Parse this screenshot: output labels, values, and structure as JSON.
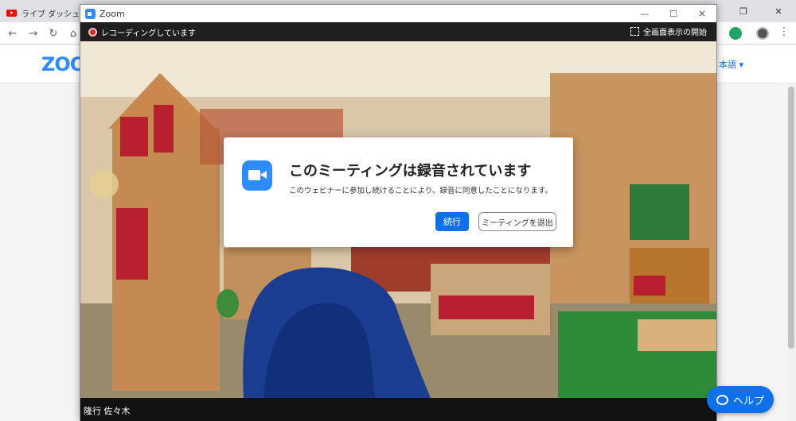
{
  "browser": {
    "tab_title": "ライブ ダッシュボ",
    "nav": {
      "back": "←",
      "forward": "→",
      "reload": "↻",
      "home": "⌂",
      "menu": "⋮"
    },
    "window_controls": {
      "minimize": "—",
      "maximize": "❐",
      "close": "✕"
    }
  },
  "site": {
    "logo": "ZOO",
    "language_link": "本語 ▾",
    "help_button": "ヘルプ"
  },
  "zoom_window": {
    "title": "Zoom",
    "recording_label": "レコーディングしています",
    "fullscreen_label": "全画面表示の開始",
    "controls": {
      "minimize": "—",
      "maximize": "☐",
      "close": "✕"
    },
    "participant_name": "隆行 佐々木"
  },
  "dialog": {
    "title": "このミーティングは録音されています",
    "message": "このウェビナーに参加し続けることにより、録音に同意したことになります。",
    "continue_button": "続行",
    "leave_button": "ミーティングを退出"
  },
  "colors": {
    "zoom_blue": "#2d8cff",
    "button_blue": "#0e71eb",
    "recording_red": "#e02828"
  }
}
